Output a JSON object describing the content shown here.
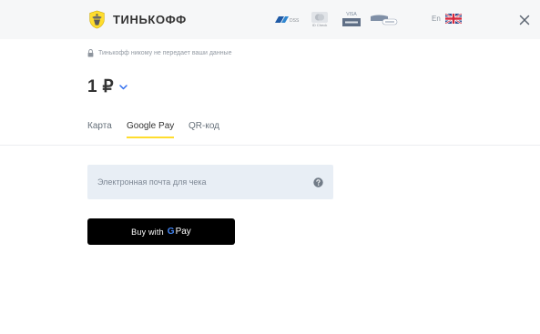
{
  "header": {
    "brand_name": "ТИНЬКОФФ",
    "payment_badges": [
      {
        "name": "pci-dss",
        "text": "DSS"
      },
      {
        "name": "mastercard-securecode",
        "text": "ID Check"
      },
      {
        "name": "verified-by-visa",
        "text": "VISA"
      },
      {
        "name": "mir-accept",
        "text": ""
      }
    ],
    "language_label": "En",
    "language_flag": "uk-flag-icon",
    "close_icon": "close-icon"
  },
  "privacy_notice": "Тинькофф никому не передает ваши данные",
  "amount": {
    "value": "1 ₽",
    "chevron_icon": "chevron-down-icon"
  },
  "tabs": [
    {
      "label": "Карта",
      "active": false
    },
    {
      "label": "Google Pay",
      "active": true
    },
    {
      "label": "QR-код",
      "active": false
    }
  ],
  "email_field": {
    "placeholder": "Электронная почта для чека",
    "value": "",
    "help_icon": "question-icon"
  },
  "gpay_button": {
    "prefix": "Buy with",
    "g_letter": "G",
    "brand": "Pay"
  },
  "colors": {
    "accent_yellow": "#ffdd2d",
    "header_bg": "#f6f7f8",
    "field_bg": "#e8eef5",
    "button_bg": "#000000",
    "link_blue": "#336fee"
  }
}
